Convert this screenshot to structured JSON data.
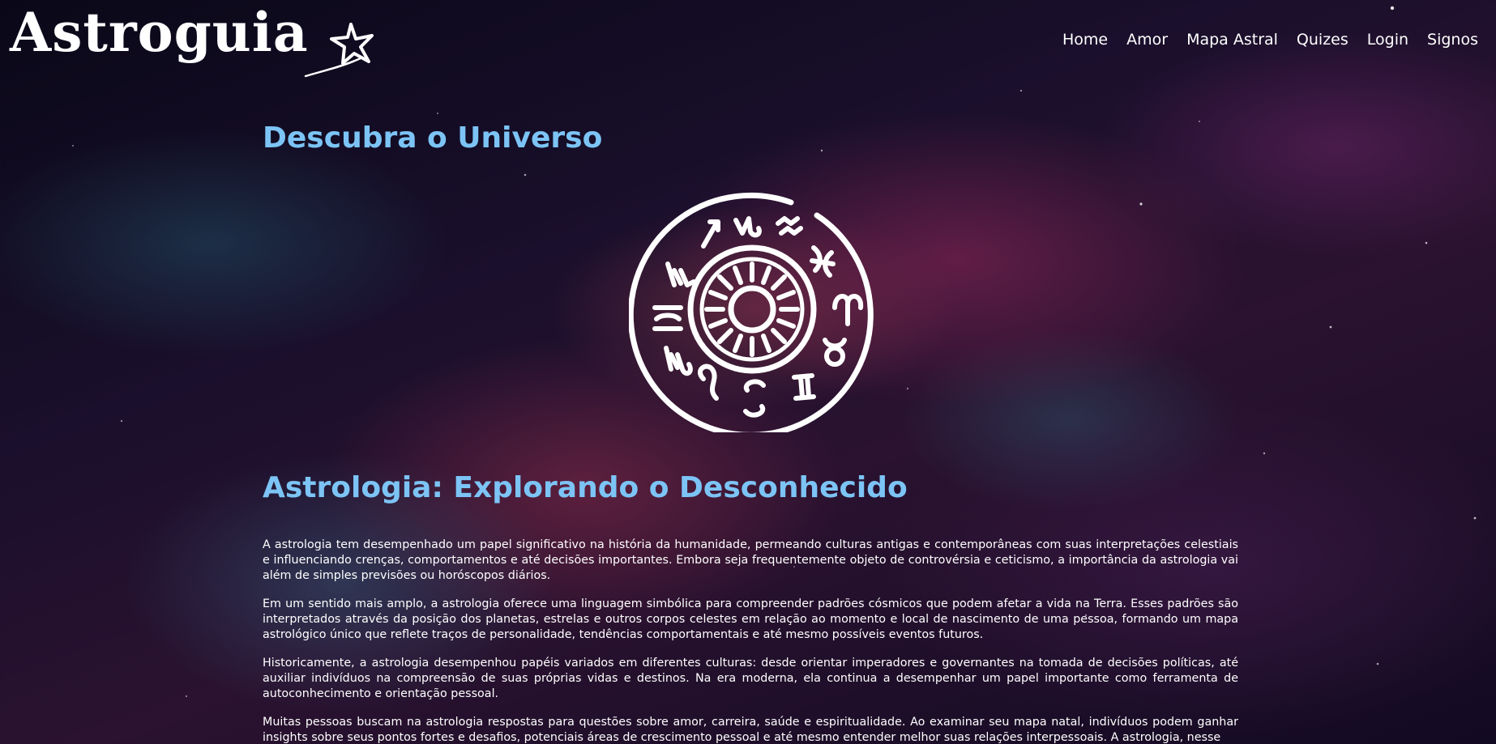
{
  "brand": {
    "logo_text": "Astroguia",
    "logo_icon": "shooting-star-icon"
  },
  "nav": {
    "items": [
      {
        "label": "Home"
      },
      {
        "label": "Amor"
      },
      {
        "label": "Mapa Astral"
      },
      {
        "label": "Quizes"
      },
      {
        "label": "Login"
      },
      {
        "label": "Signos"
      }
    ]
  },
  "hero": {
    "title": "Descubra o Universo",
    "image_icon": "zodiac-wheel-icon"
  },
  "article": {
    "title": "Astrologia: Explorando o Desconhecido",
    "paragraphs": [
      "A astrologia tem desempenhado um papel significativo na história da humanidade, permeando culturas antigas e contemporâneas com suas interpretações celestiais e influenciando crenças, comportamentos e até decisões importantes. Embora seja frequentemente objeto de controvérsia e ceticismo, a importância da astrologia vai além de simples previsões ou horóscopos diários.",
      "Em um sentido mais amplo, a astrologia oferece uma linguagem simbólica para compreender padrões cósmicos que podem afetar a vida na Terra. Esses padrões são interpretados através da posição dos planetas, estrelas e outros corpos celestes em relação ao momento e local de nascimento de uma pessoa, formando um mapa astrológico único que reflete traços de personalidade, tendências comportamentais e até mesmo possíveis eventos futuros.",
      "Historicamente, a astrologia desempenhou papéis variados em diferentes culturas: desde orientar imperadores e governantes na tomada de decisões políticas, até auxiliar indivíduos na compreensão de suas próprias vidas e destinos. Na era moderna, ela continua a desempenhar um papel importante como ferramenta de autoconhecimento e orientação pessoal.",
      "Muitas pessoas buscam na astrologia respostas para questões sobre amor, carreira, saúde e espiritualidade. Ao examinar seu mapa natal, indivíduos podem ganhar insights sobre seus pontos fortes e desafios, potenciais áreas de crescimento pessoal e até mesmo entender melhor suas relações interpessoais. A astrologia, nesse"
    ]
  },
  "colors": {
    "heading": "#7cc4f5",
    "text": "#ffffff",
    "background": "#140c24"
  }
}
